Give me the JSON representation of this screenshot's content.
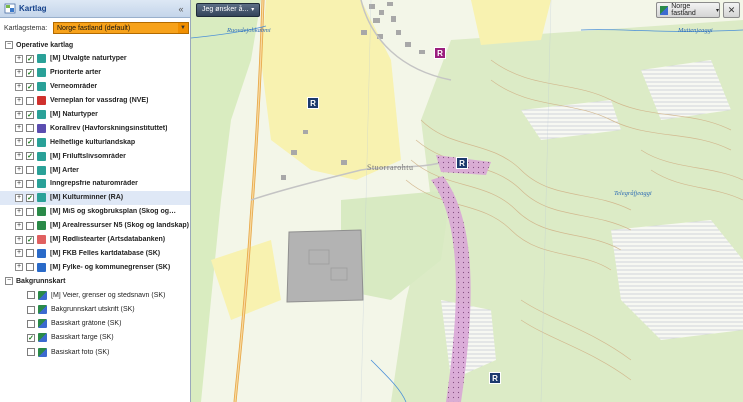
{
  "panel": {
    "title": "Kartlag",
    "close_symbol": "«",
    "theme_label": "Kartlagstema:",
    "theme_value": "Norge fastland (default)"
  },
  "groups": {
    "operative": "Operative kartlag",
    "background": "Bakgrunnskart"
  },
  "layers": [
    {
      "label": "[M] Utvalgte naturtyper",
      "checked": true,
      "icon": "nature-icon",
      "color": "#2aa198"
    },
    {
      "label": "Prioriterte arter",
      "checked": true,
      "icon": "species-icon",
      "color": "#2aa198"
    },
    {
      "label": "Verneområder",
      "checked": true,
      "icon": "protected-area-icon",
      "color": "#2aa198"
    },
    {
      "label": "Verneplan for vassdrag (NVE)",
      "checked": false,
      "icon": "waterway-icon",
      "color": "#d0312d"
    },
    {
      "label": "[M] Naturtyper",
      "checked": true,
      "icon": "nature-icon",
      "color": "#2aa198"
    },
    {
      "label": "Korallrev (Havforskningsinstituttet)",
      "checked": false,
      "icon": "coral-icon",
      "color": "#5b4db0"
    },
    {
      "label": "Helhetlige kulturlandskap",
      "checked": true,
      "icon": "landscape-icon",
      "color": "#2aa198"
    },
    {
      "label": "[M] Friluftslivsområder",
      "checked": true,
      "icon": "outdoor-icon",
      "color": "#2aa198"
    },
    {
      "label": "[M] Arter",
      "checked": false,
      "icon": "species-icon",
      "color": "#2aa198"
    },
    {
      "label": "Inngrepsfrie naturområder",
      "checked": false,
      "icon": "wilderness-icon",
      "color": "#2aa198"
    },
    {
      "label": "[M] Kulturminner (RA)",
      "checked": true,
      "icon": "heritage-icon",
      "color": "#2aa198",
      "selected": true
    },
    {
      "label": "[M] MiS og skogbruksplan (Skog og…",
      "checked": false,
      "icon": "forest-icon",
      "color": "#2a8a48"
    },
    {
      "label": "[M] Arealressurser N5 (Skog og landskap)",
      "checked": false,
      "icon": "area-resource-icon",
      "color": "#2a8a48"
    },
    {
      "label": "[M] Rødlistearter (Artsdatabanken)",
      "checked": true,
      "icon": "redlist-icon",
      "color": "#e06060"
    },
    {
      "label": "[M] FKB Felles kartdatabase (SK)",
      "checked": false,
      "icon": "map-database-icon",
      "color": "#2a6ac8"
    },
    {
      "label": "[M] Fylke- og kommunegrenser (SK)",
      "checked": false,
      "icon": "boundary-icon",
      "color": "#2a6ac8"
    }
  ],
  "background_layers": [
    {
      "label": "[M] Veier, grenser og stedsnavn (SK)",
      "checked": false,
      "icon": "roads-icon"
    },
    {
      "label": "Bakgrunnskart utskrift (SK)",
      "checked": false,
      "icon": "print-map-icon"
    },
    {
      "label": "Basiskart gråtone (SK)",
      "checked": false,
      "icon": "grayscale-map-icon"
    },
    {
      "label": "Basiskart farge (SK)",
      "checked": true,
      "icon": "color-map-icon"
    },
    {
      "label": "Basiskart foto (SK)",
      "checked": false,
      "icon": "photo-map-icon"
    }
  ],
  "map": {
    "goto_label": "Jeg ønsker å...",
    "basemap_label": "Norge fastland",
    "tools_icon": "wrench-icon",
    "labels": {
      "ruovdejohka": "Ruovdejohkabmi",
      "muttenjeaggi": "Muttenjeaggi",
      "stuorrarohtu": "Stuorrarohtu",
      "telegrafjeaggi": "Telegråfjeaggi"
    },
    "marker_letter": "R"
  },
  "colors": {
    "accent": "#f7a21b",
    "header_text": "#15428b",
    "map_bg": "#f3f6e8",
    "forest": "#d9ecc0",
    "field": "#f8f2b0",
    "trail": "#d9a6d6"
  }
}
